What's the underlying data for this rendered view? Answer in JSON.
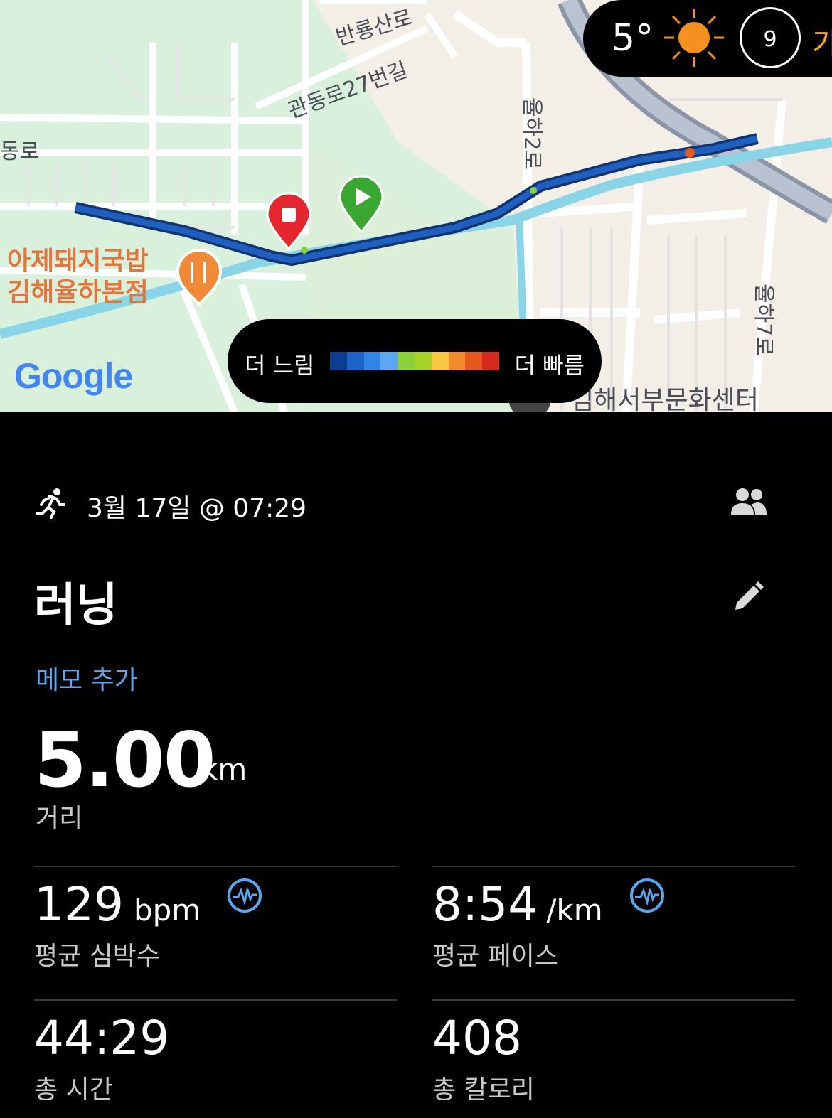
{
  "map": {
    "streets": [
      "반룡산로",
      "관동로27번길",
      "동로",
      "율하2로",
      "율하7로",
      "김해서부문화센터"
    ],
    "poi": {
      "line1": "아제돼지국밥",
      "line2": "김해율하본점"
    },
    "attribution": "Google",
    "weather": {
      "temp": "5°",
      "uv": "9",
      "next": "가"
    },
    "legend": {
      "slow": "더 느림",
      "fast": "더 빠름",
      "colors": [
        "#0b3e8f",
        "#1e64c8",
        "#2f86e3",
        "#5ba8f0",
        "#8bd13b",
        "#a6d32a",
        "#f7c744",
        "#f28c2b",
        "#e55a1c",
        "#d62a1e"
      ]
    }
  },
  "activity": {
    "date": "3월 17일 @ 07:29",
    "title": "러닝",
    "memo_link": "메모 추가",
    "distance": {
      "value": "5.00",
      "unit": "km",
      "label": "거리"
    },
    "stats": [
      {
        "value": "129",
        "unit": "bpm",
        "label": "평균 심박수"
      },
      {
        "value": "8:54",
        "unit": "/km",
        "label": "평균 페이스"
      },
      {
        "value": "44:29",
        "unit": "",
        "label": "총 시간"
      },
      {
        "value": "408",
        "unit": "",
        "label": "총 칼로리"
      }
    ]
  }
}
